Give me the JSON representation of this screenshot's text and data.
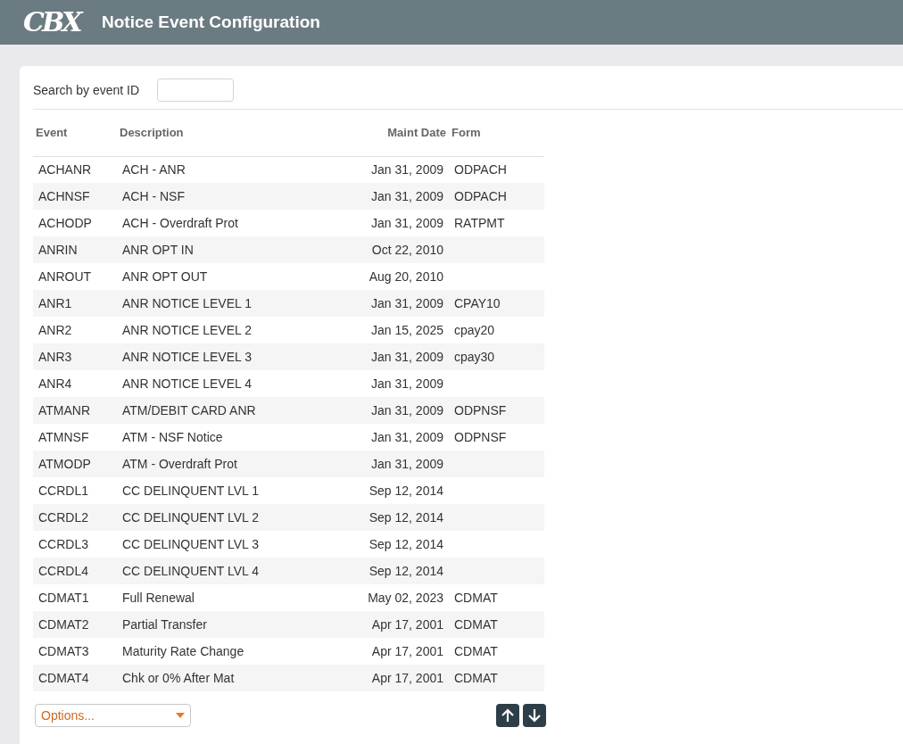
{
  "header": {
    "logo": "CBX",
    "title": "Notice Event Configuration"
  },
  "search": {
    "label": "Search by event ID"
  },
  "table": {
    "columns": [
      "Event",
      "Description",
      "Maint Date",
      "Form"
    ],
    "rows": [
      [
        "ACHANR",
        "ACH - ANR",
        "Jan 31, 2009",
        "ODPACH"
      ],
      [
        "ACHNSF",
        "ACH - NSF",
        "Jan 31, 2009",
        "ODPACH"
      ],
      [
        "ACHODP",
        "ACH - Overdraft Prot",
        "Jan 31, 2009",
        "RATPMT"
      ],
      [
        "ANRIN",
        "ANR OPT IN",
        "Oct 22, 2010",
        ""
      ],
      [
        "ANROUT",
        "ANR OPT OUT",
        "Aug 20, 2010",
        ""
      ],
      [
        "ANR1",
        "ANR NOTICE LEVEL 1",
        "Jan 31, 2009",
        "CPAY10"
      ],
      [
        "ANR2",
        "ANR NOTICE LEVEL 2",
        "Jan 15, 2025",
        "cpay20"
      ],
      [
        "ANR3",
        "ANR NOTICE LEVEL 3",
        "Jan 31, 2009",
        "cpay30"
      ],
      [
        "ANR4",
        "ANR NOTICE LEVEL 4",
        "Jan 31, 2009",
        ""
      ],
      [
        "ATMANR",
        "ATM/DEBIT CARD ANR",
        "Jan 31, 2009",
        "ODPNSF"
      ],
      [
        "ATMNSF",
        "ATM - NSF Notice",
        "Jan 31, 2009",
        "ODPNSF"
      ],
      [
        "ATMODP",
        "ATM - Overdraft Prot",
        "Jan 31, 2009",
        ""
      ],
      [
        "CCRDL1",
        "CC DELINQUENT LVL 1",
        "Sep 12, 2014",
        ""
      ],
      [
        "CCRDL2",
        "CC DELINQUENT LVL 2",
        "Sep 12, 2014",
        ""
      ],
      [
        "CCRDL3",
        "CC DELINQUENT LVL 3",
        "Sep 12, 2014",
        ""
      ],
      [
        "CCRDL4",
        "CC DELINQUENT LVL 4",
        "Sep 12, 2014",
        ""
      ],
      [
        "CDMAT1",
        "Full Renewal",
        "May 02, 2023",
        "CDMAT"
      ],
      [
        "CDMAT2",
        "Partial Transfer",
        "Apr 17, 2001",
        "CDMAT"
      ],
      [
        "CDMAT3",
        "Maturity Rate Change",
        "Apr 17, 2001",
        "CDMAT"
      ],
      [
        "CDMAT4",
        "Chk or 0% After Mat",
        "Apr 17, 2001",
        "CDMAT"
      ]
    ]
  },
  "options": {
    "placeholder": "Options..."
  }
}
